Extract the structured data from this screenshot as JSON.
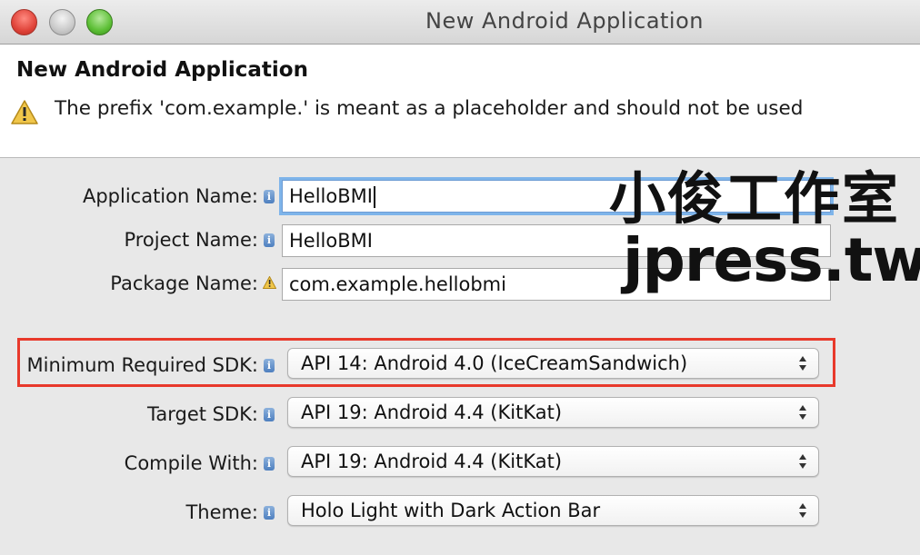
{
  "window": {
    "title": "New Android Application"
  },
  "header": {
    "title": "New Android Application",
    "message": "The prefix 'com.example.' is meant as a placeholder and should not be used",
    "message_icon": "warning-icon"
  },
  "form": {
    "application_name": {
      "label": "Application Name:",
      "value": "HelloBMI",
      "icon": "info-icon"
    },
    "project_name": {
      "label": "Project Name:",
      "value": "HelloBMI",
      "icon": "info-icon"
    },
    "package_name": {
      "label": "Package Name:",
      "value": "com.example.hellobmi",
      "icon": "warning-icon"
    },
    "minimum_sdk": {
      "label": "Minimum Required SDK:",
      "value": "API 14: Android 4.0 (IceCreamSandwich)",
      "icon": "info-icon"
    },
    "target_sdk": {
      "label": "Target SDK:",
      "value": "API 19: Android 4.4 (KitKat)",
      "icon": "info-icon"
    },
    "compile_with": {
      "label": "Compile With:",
      "value": "API 19: Android 4.4 (KitKat)",
      "icon": "info-icon"
    },
    "theme": {
      "label": "Theme:",
      "value": "Holo Light with Dark Action Bar",
      "icon": "info-icon"
    }
  },
  "watermark": {
    "line1": "小俊工作室",
    "line2": "jpress.tw"
  },
  "colors": {
    "highlight": "#e8392b",
    "focus_ring": "#7eb4ea",
    "info_icon": "#4e7fbf",
    "warning_icon": "#e8b83a"
  }
}
